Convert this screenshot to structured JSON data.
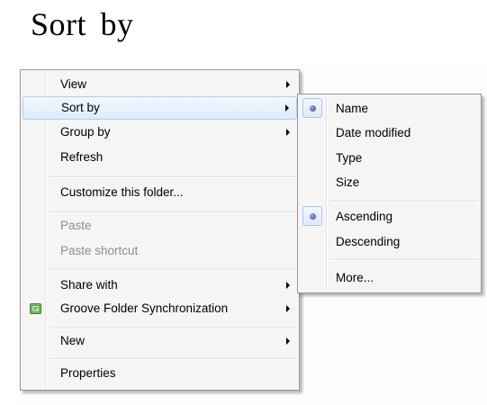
{
  "page": {
    "title": "Sort by"
  },
  "context_menu": {
    "items": [
      {
        "label": "View",
        "has_submenu": true
      },
      {
        "label": "Sort by",
        "has_submenu": true,
        "state": "highlighted"
      },
      {
        "label": "Group by",
        "has_submenu": true
      },
      {
        "label": "Refresh"
      },
      {
        "label": "Customize this folder..."
      },
      {
        "label": "Paste",
        "state": "disabled"
      },
      {
        "label": "Paste shortcut",
        "state": "disabled"
      },
      {
        "label": "Share with",
        "has_submenu": true
      },
      {
        "label": "Groove Folder Synchronization",
        "has_submenu": true,
        "icon": "groove-sync-icon"
      },
      {
        "label": "New",
        "has_submenu": true
      },
      {
        "label": "Properties"
      }
    ]
  },
  "sort_submenu": {
    "items": [
      {
        "label": "Name",
        "selected": true
      },
      {
        "label": "Date modified"
      },
      {
        "label": "Type"
      },
      {
        "label": "Size"
      },
      {
        "label": "Ascending",
        "selected": true
      },
      {
        "label": "Descending"
      },
      {
        "label": "More..."
      }
    ]
  },
  "colors": {
    "menu_background": "#f5f5f5",
    "highlight_border": "#aecff7",
    "radio_dot": "#4a4ab8"
  }
}
